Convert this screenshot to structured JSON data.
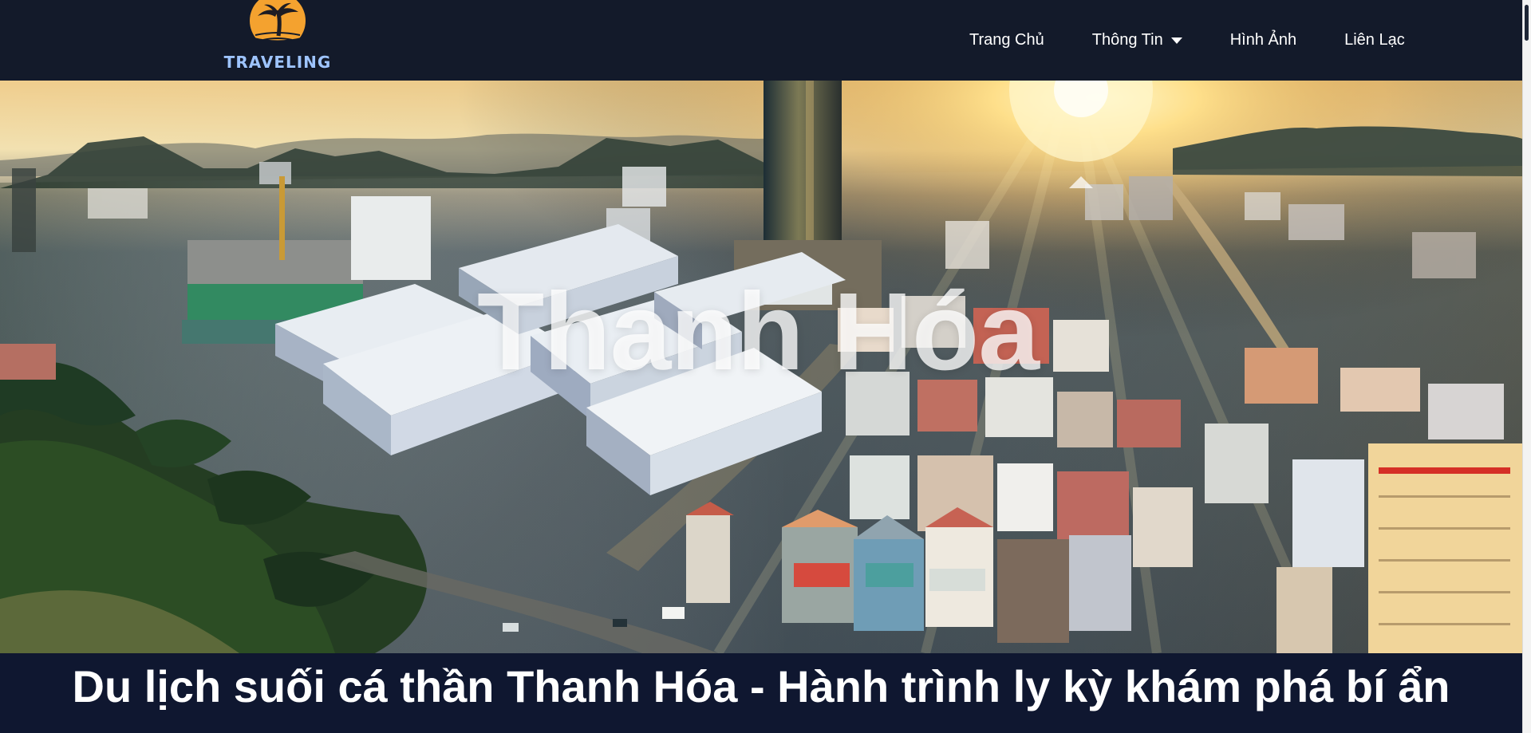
{
  "brand": {
    "name": "TRAVELING"
  },
  "navbar": {
    "items": [
      {
        "label": "Trang Chủ"
      },
      {
        "label": "Thông Tin"
      },
      {
        "label": "Hình Ảnh"
      },
      {
        "label": "Liên Lạc"
      }
    ]
  },
  "hero": {
    "title": "Thanh Hóa"
  },
  "headline": {
    "text": "Du lịch suối cá thần Thanh Hóa - Hành trình ly kỳ khám phá bí ẩn"
  },
  "colors": {
    "navbar_bg": "#131a2a",
    "logo_sun": "#f4a22f",
    "logo_text": "#9ec4ff",
    "headline_bg": "#0f1730",
    "text_white": "#ffffff"
  },
  "icons": {
    "logo": "sun-palm-icon",
    "dropdown": "caret-down-icon"
  }
}
